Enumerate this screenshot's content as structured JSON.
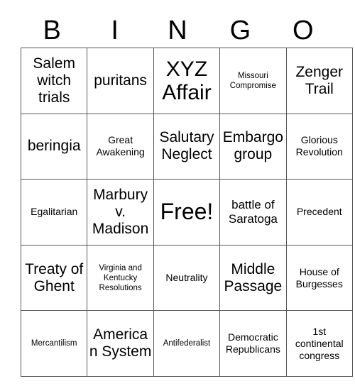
{
  "card": {
    "title": "BINGO",
    "header_letters": [
      "B",
      "I",
      "N",
      "G",
      "O"
    ],
    "free_space_label": "Free!",
    "colors": {
      "background": "#ffffff",
      "text": "#000000",
      "grid_border": "#555555",
      "outer_border": "#3a3a3a"
    },
    "grid": {
      "columns": 5,
      "rows": 5,
      "cells": [
        [
          {
            "text": "Salem witch trials",
            "size": "lg"
          },
          {
            "text": "puritans",
            "size": "lg"
          },
          {
            "text": "XYZ Affair",
            "size": "xl"
          },
          {
            "text": "Missouri Compromise",
            "size": "xs"
          },
          {
            "text": "Zenger Trail",
            "size": "lg"
          }
        ],
        [
          {
            "text": "beringia",
            "size": "lg"
          },
          {
            "text": "Great Awakening",
            "size": "sm"
          },
          {
            "text": "Salutary Neglect",
            "size": "lg"
          },
          {
            "text": "Embargo group",
            "size": "lg"
          },
          {
            "text": "Glorious Revolution",
            "size": "sm"
          }
        ],
        [
          {
            "text": "Egalitarian",
            "size": "sm"
          },
          {
            "text": "Marbury v. Madison",
            "size": "lg"
          },
          {
            "text": "Free!",
            "size": "free"
          },
          {
            "text": "battle of Saratoga",
            "size": "md"
          },
          {
            "text": "Precedent",
            "size": "sm"
          }
        ],
        [
          {
            "text": "Treaty of Ghent",
            "size": "lg"
          },
          {
            "text": "Virginia and Kentucky Resolutions",
            "size": "xs"
          },
          {
            "text": "Neutrality",
            "size": "sm"
          },
          {
            "text": "Middle Passage",
            "size": "lg"
          },
          {
            "text": "House of Burgesses",
            "size": "sm"
          }
        ],
        [
          {
            "text": "Mercantilism",
            "size": "xs"
          },
          {
            "text": "American System",
            "size": "lg"
          },
          {
            "text": "Antifederalist",
            "size": "xs"
          },
          {
            "text": "Democratic Republicans",
            "size": "sm"
          },
          {
            "text": "1st continental congress",
            "size": "sm"
          }
        ]
      ]
    }
  }
}
